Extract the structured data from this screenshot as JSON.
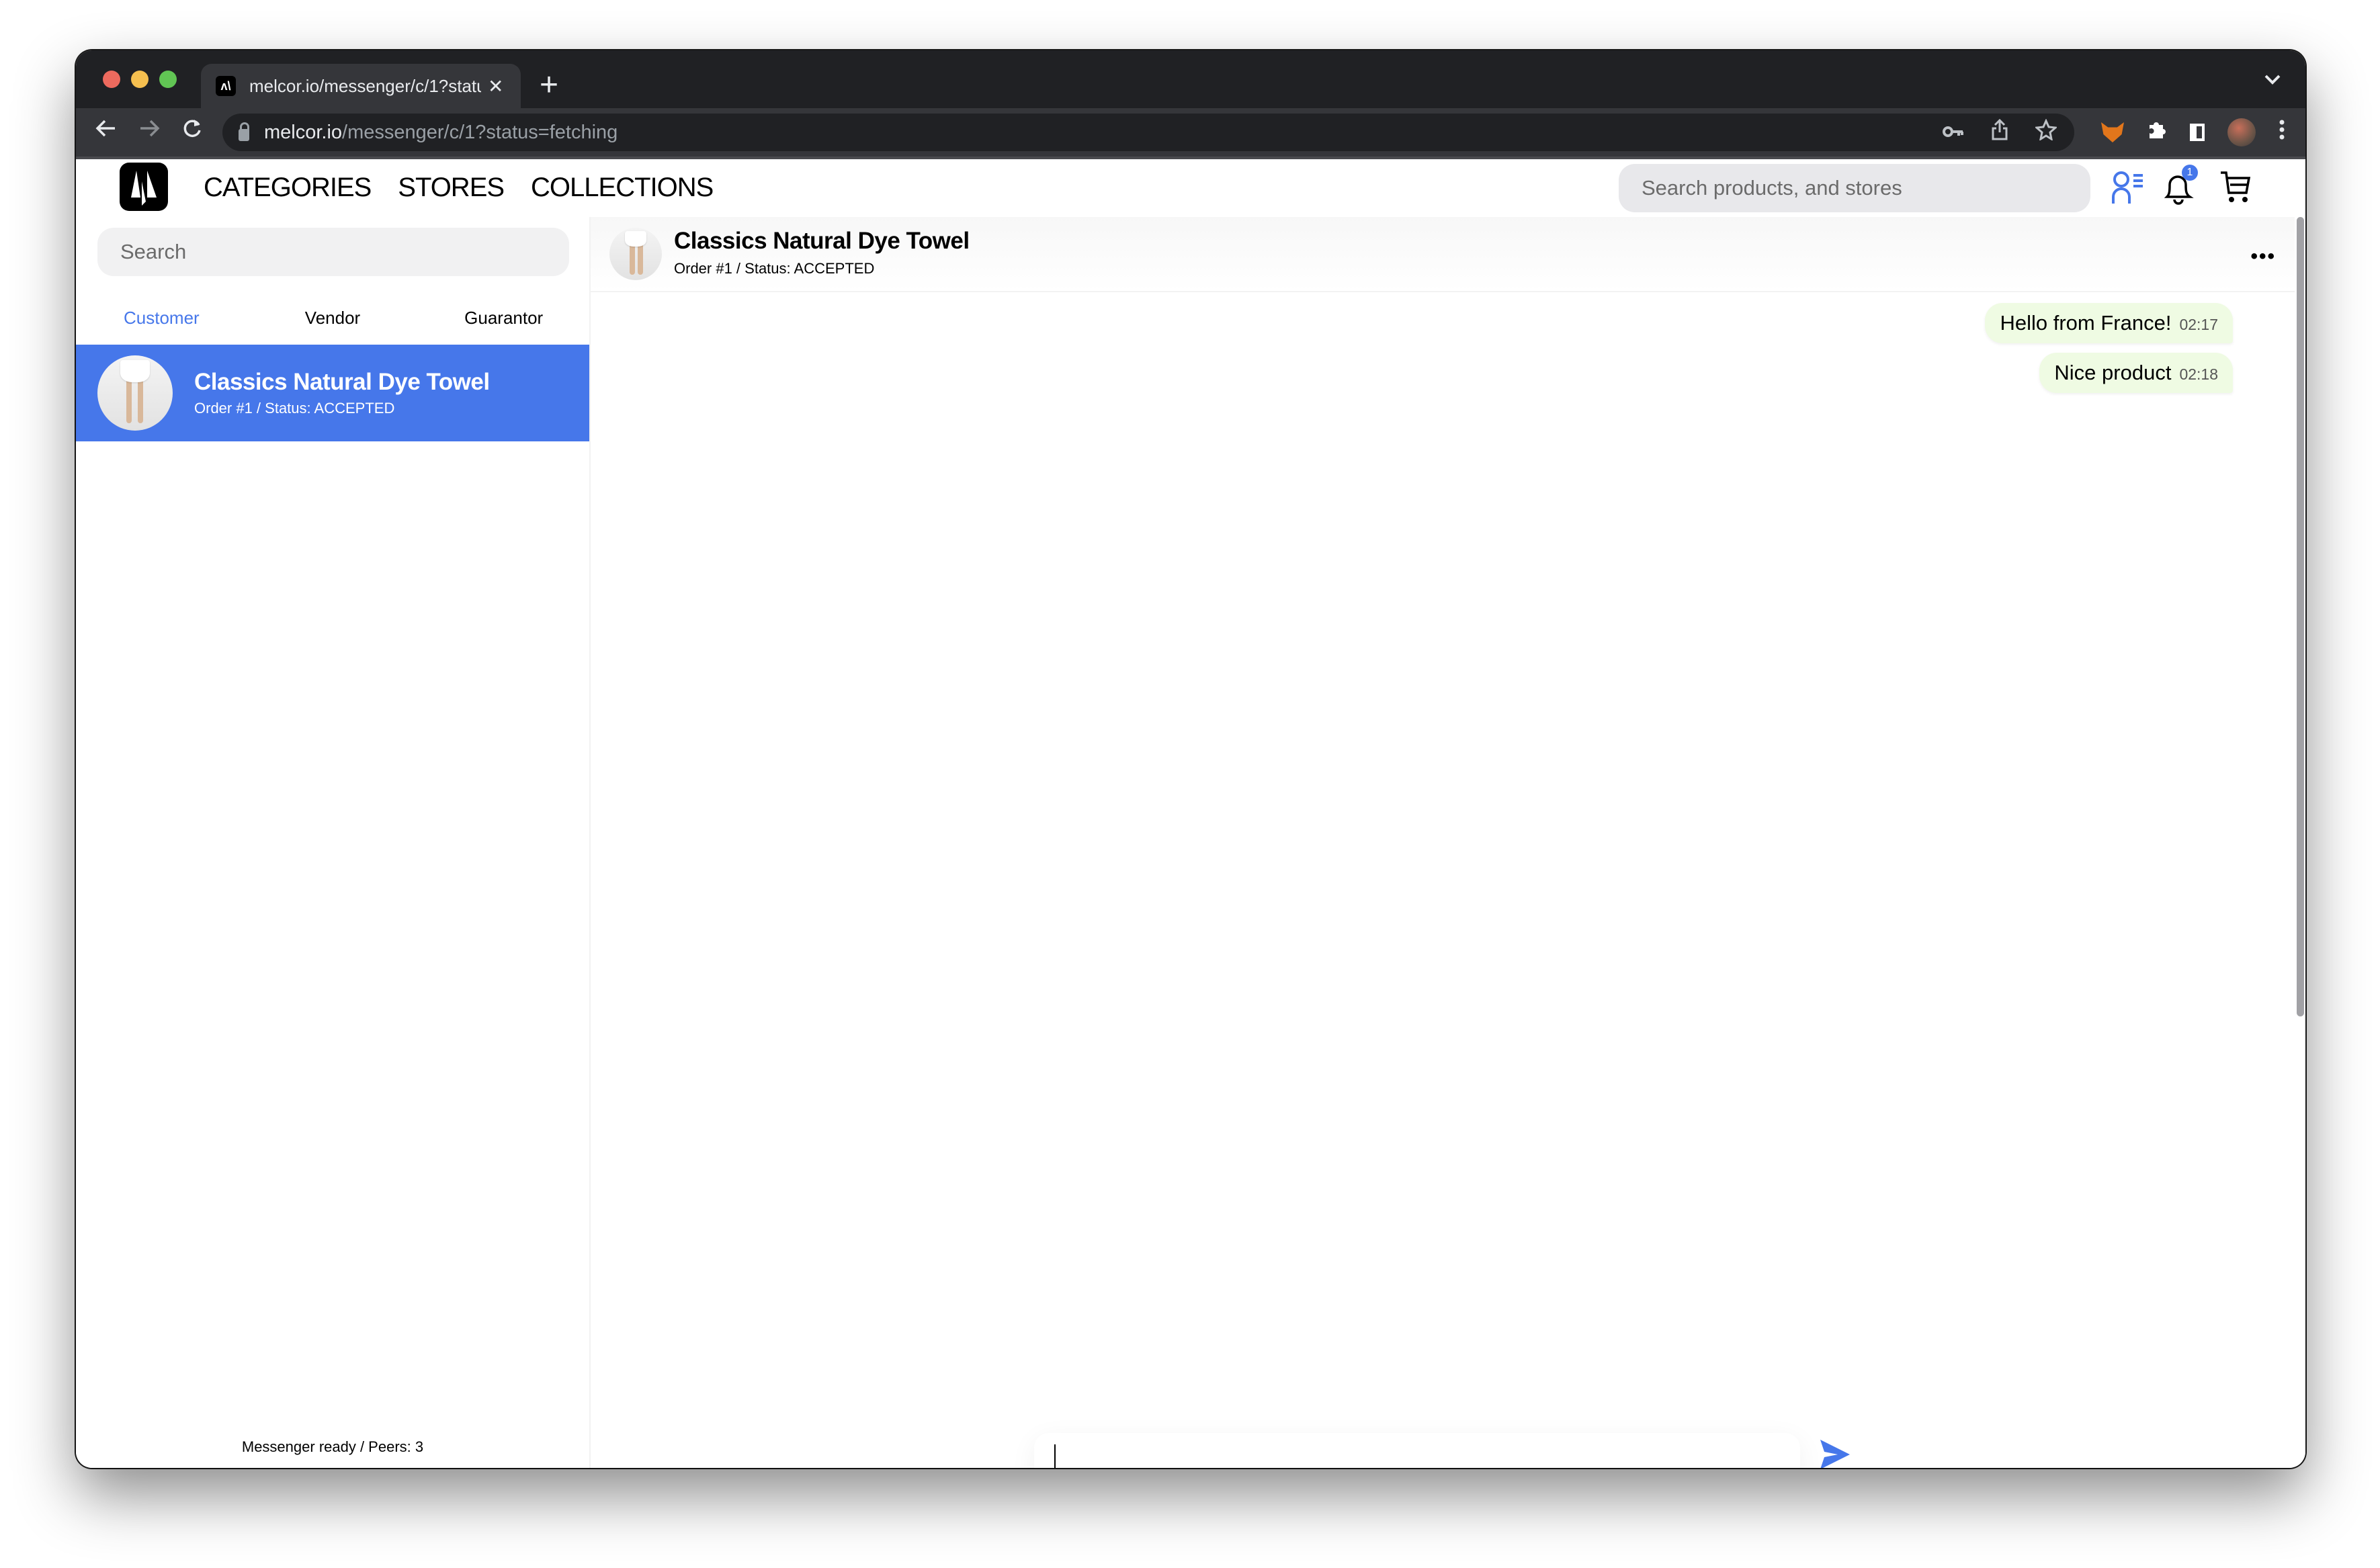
{
  "browser": {
    "tab_title": "melcor.io/messenger/c/1?status=fetching",
    "tab_favicon": "melcor-logo-icon",
    "url_host": "melcor.io",
    "url_path": "/messenger/c/1?status=fetching",
    "traffic_lights": {
      "close": "#ed6a5e",
      "minimize": "#f5bf4f",
      "maximize": "#61c554"
    }
  },
  "site": {
    "nav": [
      "CATEGORIES",
      "STORES",
      "COLLECTIONS"
    ],
    "search_placeholder": "Search products, and stores",
    "notification_count": "1",
    "accent_color": "#4677ea"
  },
  "sidebar": {
    "search_placeholder": "Search",
    "tabs": [
      {
        "label": "Customer",
        "active": true
      },
      {
        "label": "Vendor",
        "active": false
      },
      {
        "label": "Guarantor",
        "active": false
      }
    ],
    "conversations": [
      {
        "title": "Classics Natural Dye Towel",
        "subtitle": "Order #1 / Status: ACCEPTED",
        "selected": true
      }
    ],
    "status": "Messenger ready / Peers: 3"
  },
  "chat": {
    "title": "Classics Natural Dye Towel",
    "subtitle": "Order #1 / Status: ACCEPTED",
    "more_label": "•••",
    "messages": [
      {
        "text": "Hello from France!",
        "time": "02:17",
        "outgoing": true
      },
      {
        "text": "Nice product",
        "time": "02:18",
        "outgoing": true
      }
    ],
    "composer_value": ""
  }
}
